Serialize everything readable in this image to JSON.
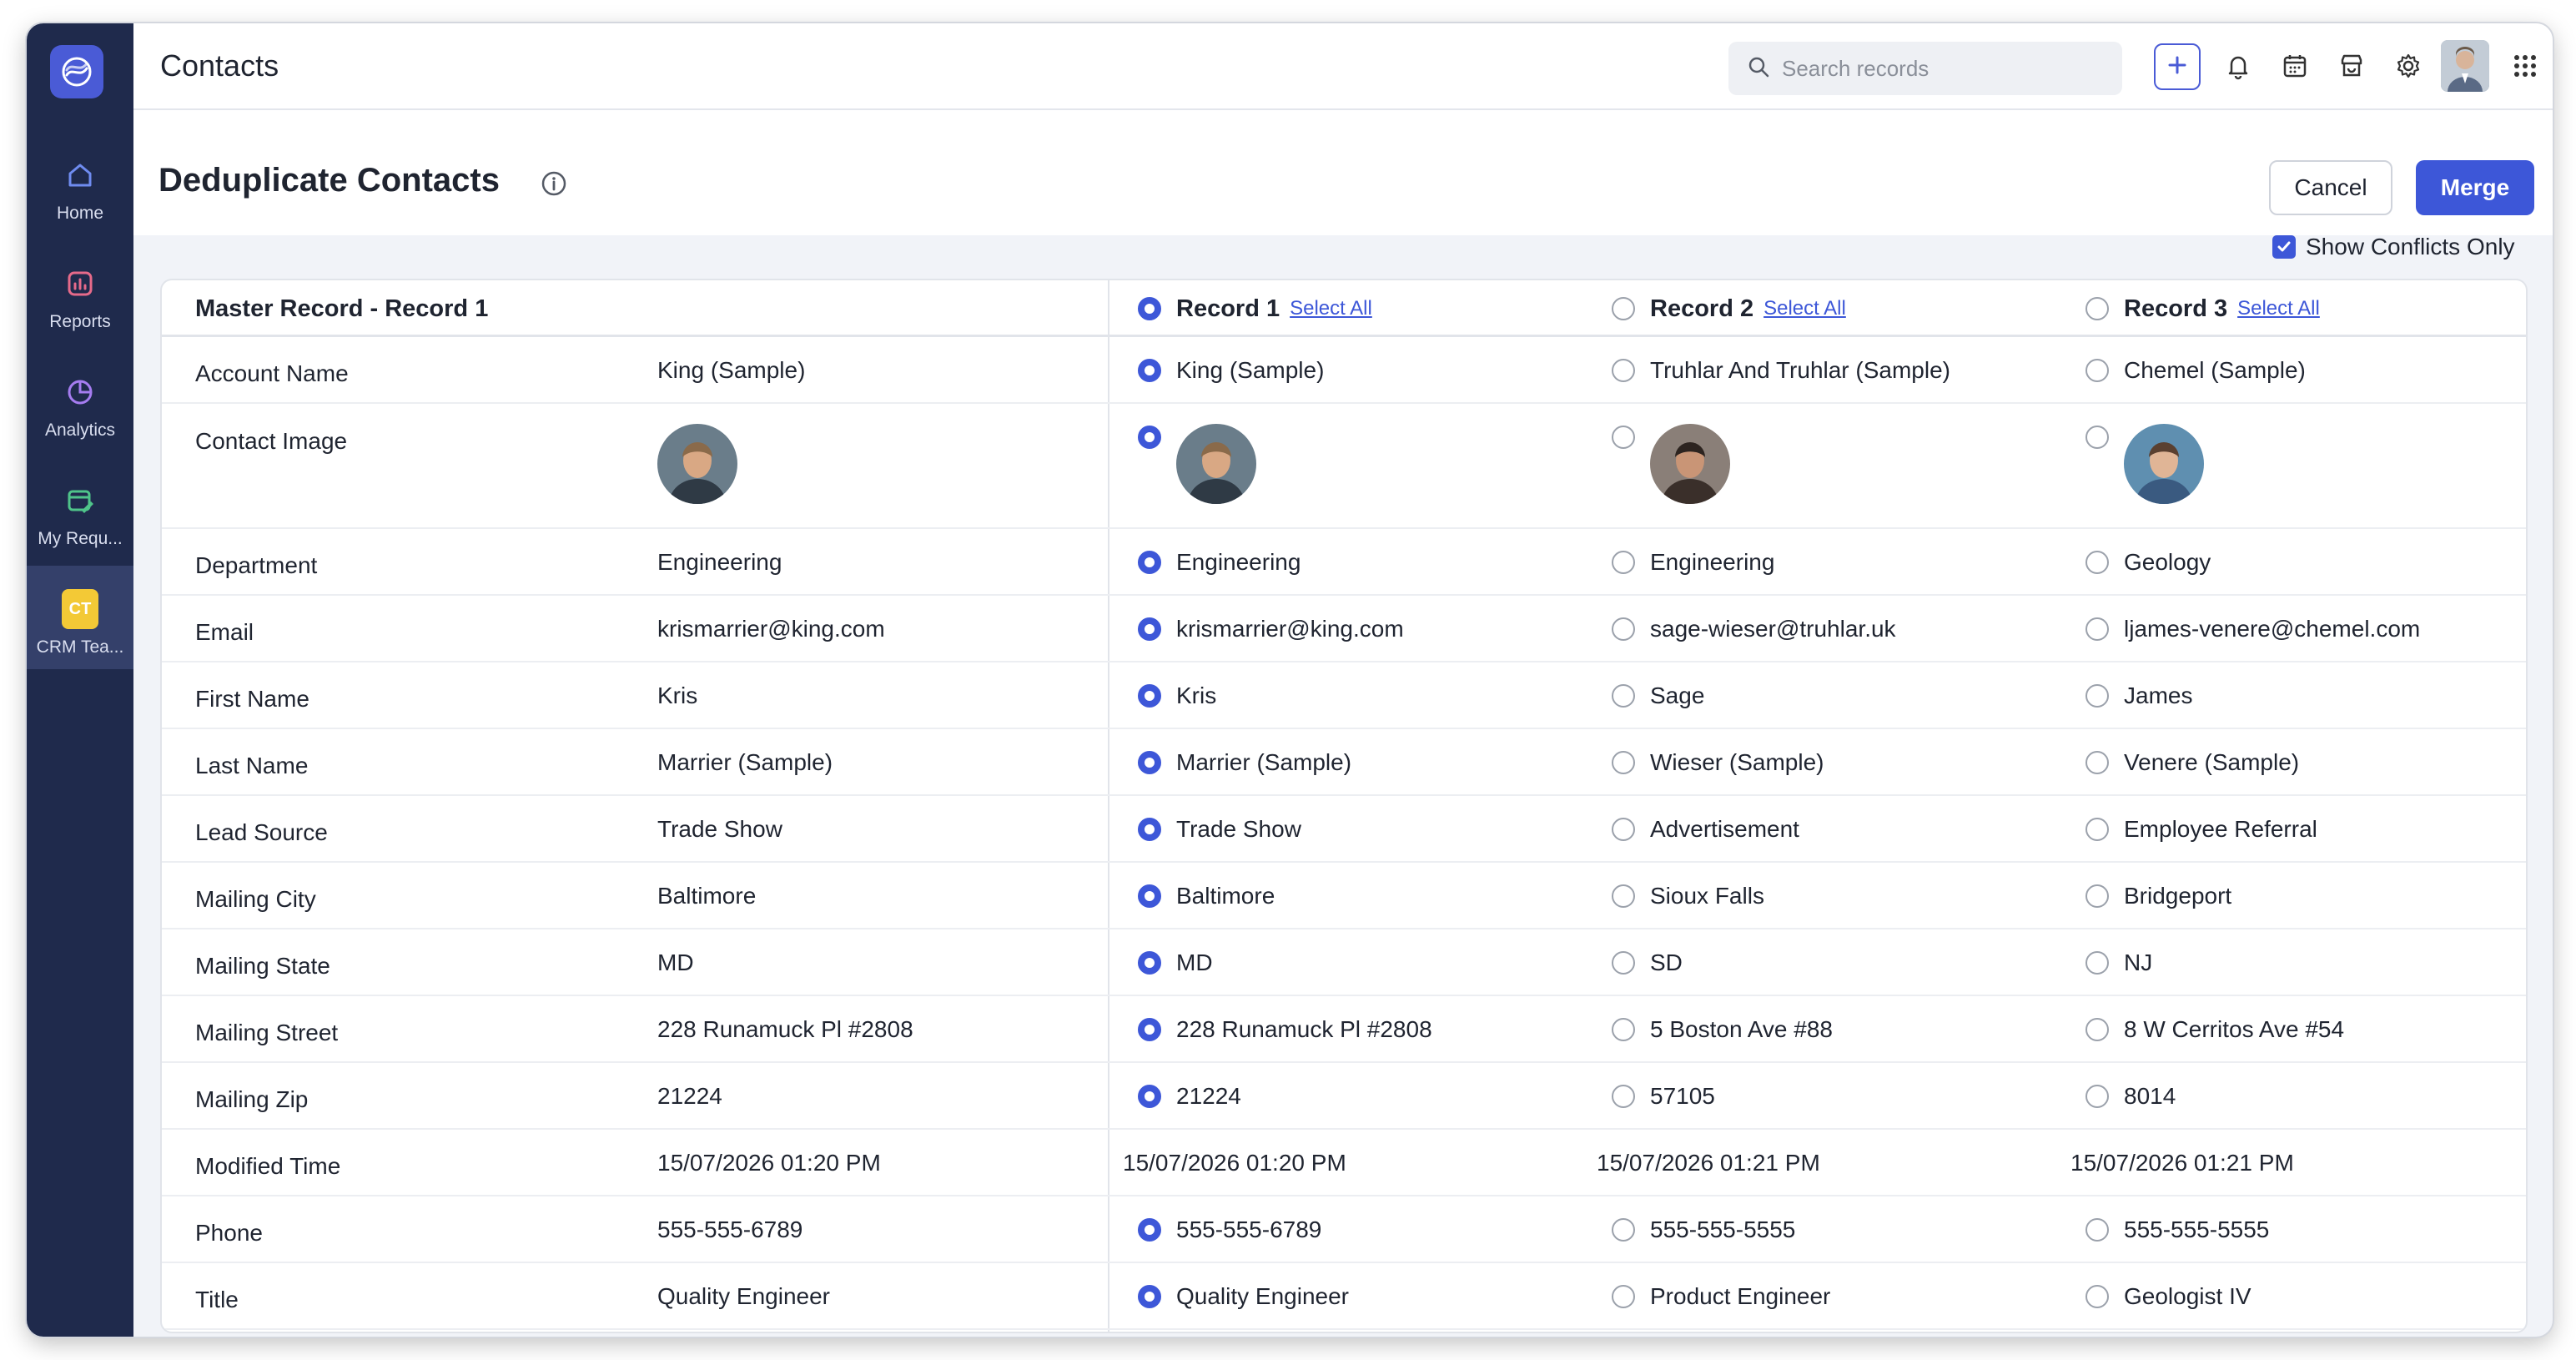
{
  "colors": {
    "sidebar_bg": "#1f2a4c",
    "accent": "#3d57d8",
    "ct_badge": "#f3c936"
  },
  "sidebar": {
    "items": [
      {
        "label": "Home",
        "icon": "home-icon"
      },
      {
        "label": "Reports",
        "icon": "reports-icon"
      },
      {
        "label": "Analytics",
        "icon": "analytics-icon"
      },
      {
        "label": "My Requ...",
        "icon": "requests-icon"
      },
      {
        "label": "CRM Tea...",
        "icon": "ct-badge",
        "badge": "CT",
        "active": true
      }
    ]
  },
  "topbar": {
    "title": "Contacts",
    "search_placeholder": "Search records",
    "icons": [
      "plus-icon",
      "bell-icon",
      "calendar-icon",
      "marketplace-icon",
      "gear-icon",
      "avatar",
      "apps-grid-icon"
    ]
  },
  "page": {
    "title": "Deduplicate Contacts",
    "cancel_label": "Cancel",
    "merge_label": "Merge",
    "show_conflicts_label": "Show Conflicts Only",
    "show_conflicts_checked": true
  },
  "table": {
    "master_header": "Master Record - Record 1",
    "select_all_label": "Select All",
    "records": [
      "Record 1",
      "Record 2",
      "Record 3"
    ],
    "selected_record": 0,
    "rows": [
      {
        "label": "Account Name",
        "master": "King (Sample)",
        "values": [
          "King (Sample)",
          "Truhlar And Truhlar (Sample)",
          "Chemel (Sample)"
        ],
        "selectable": true
      },
      {
        "label": "Contact Image",
        "master": "",
        "values": [
          "",
          "",
          ""
        ],
        "selectable": true,
        "image": true
      },
      {
        "label": "Department",
        "master": "Engineering",
        "values": [
          "Engineering",
          "Engineering",
          "Geology"
        ],
        "selectable": true
      },
      {
        "label": "Email",
        "master": "krismarrier@king.com",
        "values": [
          "krismarrier@king.com",
          "sage-wieser@truhlar.uk",
          "ljames-venere@chemel.com"
        ],
        "selectable": true
      },
      {
        "label": "First Name",
        "master": "Kris",
        "values": [
          "Kris",
          "Sage",
          "James"
        ],
        "selectable": true
      },
      {
        "label": "Last Name",
        "master": "Marrier (Sample)",
        "values": [
          "Marrier (Sample)",
          "Wieser (Sample)",
          "Venere (Sample)"
        ],
        "selectable": true
      },
      {
        "label": "Lead Source",
        "master": "Trade Show",
        "values": [
          "Trade Show",
          "Advertisement",
          "Employee Referral"
        ],
        "selectable": true
      },
      {
        "label": "Mailing City",
        "master": "Baltimore",
        "values": [
          "Baltimore",
          "Sioux Falls",
          "Bridgeport"
        ],
        "selectable": true
      },
      {
        "label": "Mailing State",
        "master": "MD",
        "values": [
          "MD",
          "SD",
          "NJ"
        ],
        "selectable": true
      },
      {
        "label": "Mailing Street",
        "master": "228 Runamuck Pl #2808",
        "values": [
          "228 Runamuck Pl #2808",
          "5 Boston Ave #88",
          "8 W Cerritos Ave #54"
        ],
        "selectable": true
      },
      {
        "label": "Mailing Zip",
        "master": "21224",
        "values": [
          "21224",
          "57105",
          "8014"
        ],
        "selectable": true
      },
      {
        "label": "Modified Time",
        "master": "15/07/2026 01:20 PM",
        "values": [
          "15/07/2026 01:20 PM",
          "15/07/2026 01:21 PM",
          "15/07/2026 01:21 PM"
        ],
        "selectable": false
      },
      {
        "label": "Phone",
        "master": "555-555-6789",
        "values": [
          "555-555-6789",
          "555-555-5555",
          "555-555-5555"
        ],
        "selectable": true
      },
      {
        "label": "Title",
        "master": "Quality Engineer",
        "values": [
          "Quality Engineer",
          "Product Engineer",
          "Geologist IV"
        ],
        "selectable": true
      }
    ]
  }
}
